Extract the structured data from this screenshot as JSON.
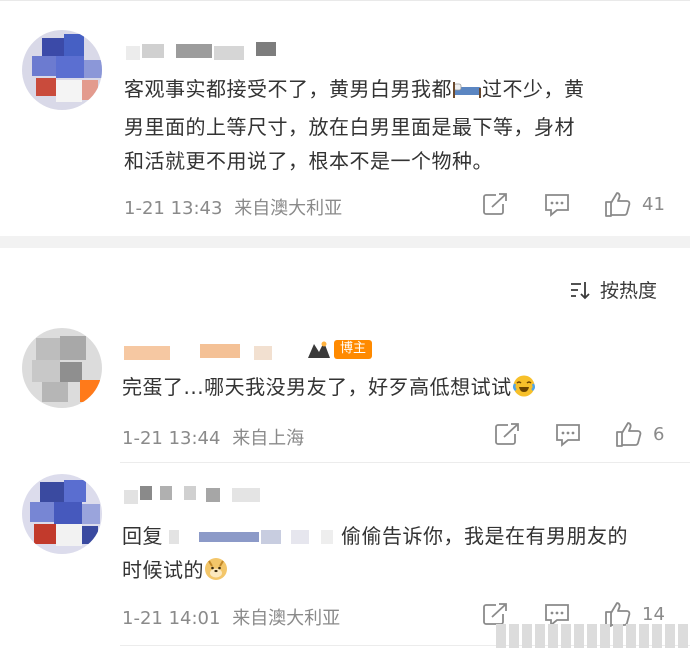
{
  "sort": {
    "label": "按热度",
    "icon": "sort-icon"
  },
  "comments": [
    {
      "text_before_emoji": "客观事实都接受不了，黄男白男我都",
      "emoji": "bed-emoji",
      "text_after_emoji": "过不少，黄男里面的上等尺寸，放在白男里面是最下等，身材和活就更不用说了，根本不是一个物种。",
      "line1_a": "客观事实都接受不了，黄男白男我都",
      "line1_b": "过不少，黄",
      "line2": "男里面的上等尺寸，放在白男里面是最下等，身材",
      "line3": "和活就更不用说了，根本不是一个物种。",
      "time": "1-21 13:43",
      "location": "来自澳大利亚",
      "likes": "41"
    },
    {
      "badge": "博主",
      "text": "完蛋了...哪天我没男友了，好歹高低想试试",
      "emoji": "crying-laughing-emoji",
      "time": "1-21 13:44",
      "location": "来自上海",
      "likes": "6"
    },
    {
      "reply_prefix": "回复",
      "text_after_mention": "偷偷告诉你，我是在有男朋友的",
      "line2": "时候试的",
      "emoji": "doge-emoji",
      "time": "1-21 14:01",
      "location": "来自澳大利亚",
      "likes": "14"
    }
  ],
  "colors": {
    "meta": "#8a8a8a",
    "badge": "#ff8a00",
    "separator": "#f2f2f2"
  }
}
